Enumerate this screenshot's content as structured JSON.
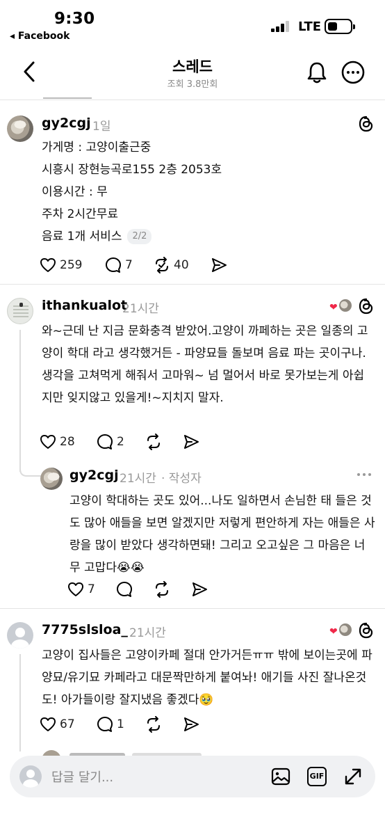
{
  "status_bar": {
    "time": "9:30",
    "back_app": "◂ Facebook",
    "network": "LTE",
    "battery_level": 0.4
  },
  "nav": {
    "title": "스레드",
    "views": "조회 3.8만회"
  },
  "post": {
    "username": "gy2cgj",
    "time": "1일",
    "lines": [
      "가게명 : 고양이출근중",
      "시흥시 장현능곡로155 2층 2053호",
      "이용시간 : 무",
      "주차 2시간무료",
      "음료 1개 서비스"
    ],
    "page": "2/2",
    "likes": "259",
    "comments": "7",
    "reposts": "40"
  },
  "comments": [
    {
      "username": "ithankualot",
      "time": "21시간",
      "text": "와~근데 난 지금 문화충격 받았어.고양이 까페하는 곳은 일종의 고양이 학대 라고 생각했거든 - 파양묘들 돌보며 음료 파는 곳이구나. 생각을 고쳐먹게 해줘서 고마워~ 넘 멀어서 바로 못가보는게 아쉽지만 잊지않고 있을게!~지치지 말자.",
      "likes": "28",
      "comments": "2",
      "reply": {
        "username": "gy2cgj",
        "time": "21시간",
        "author_tag": "· 작성자",
        "text": "고양이 학대하는 곳도 있어...나도 일하면서 손님한 태 들은 것도 많아 애들을 보면 알겠지만 저렇게 편안하게 자는 애들은 사랑을 많이 받았다 생각하면돼! 그리고 오고싶은 그 마음은 너무 고맙다😭😭",
        "likes": "7"
      }
    },
    {
      "username": "7775slsloa_",
      "time": "21시간",
      "text": "고양이 집사들은 고양이카페 절대 안가거든ㅠㅠ 밖에 보이는곳에 파양묘/유기묘 카페라고 대문짝만하게 붙여놔! 애기들 사진 잘나온것도! 아가들이랑 잘지냈음 좋겠다🥹",
      "likes": "67",
      "comments": "1"
    }
  ],
  "reply_bar": {
    "placeholder": "답글 달기...",
    "gif_label": "GIF"
  },
  "icons": [
    "back-chevron-icon",
    "bell-icon",
    "more-icon",
    "threads-icon",
    "heart-icon",
    "comment-icon",
    "repost-icon",
    "share-icon",
    "image-icon",
    "expand-icon"
  ]
}
